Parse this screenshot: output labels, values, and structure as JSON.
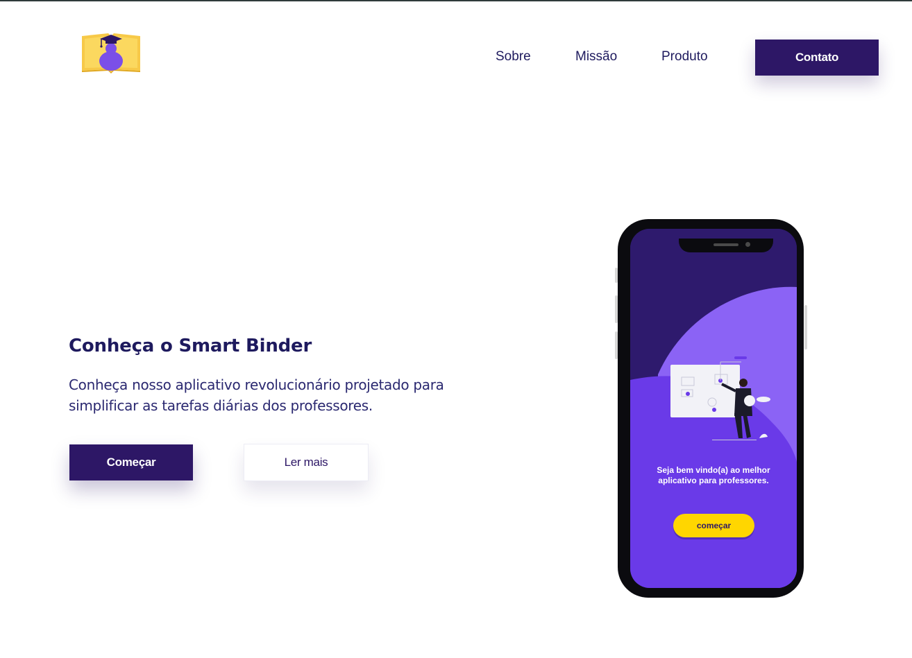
{
  "brand": {
    "logo_icon": "graduate-book-logo-icon"
  },
  "nav": {
    "items": [
      {
        "label": "Sobre"
      },
      {
        "label": "Missão"
      },
      {
        "label": "Produto"
      }
    ],
    "contact_label": "Contato"
  },
  "hero": {
    "title": "Conheça o Smart Binder",
    "description": "Conheça nosso aplicativo revolucionário projetado para simplificar as tarefas diárias dos professores.",
    "start_label": "Começar",
    "more_label": "Ler mais"
  },
  "phone": {
    "welcome_text": "Seja bem vindo(a) ao melhor aplicativo para professores.",
    "button_label": "começar"
  },
  "colors": {
    "primary": "#2d1766",
    "text": "#1e1a5e",
    "screen_dark": "#2e1a6d",
    "screen_light": "#8b63f5",
    "screen_mid": "#6a3ae8",
    "accent": "#ffd600"
  }
}
